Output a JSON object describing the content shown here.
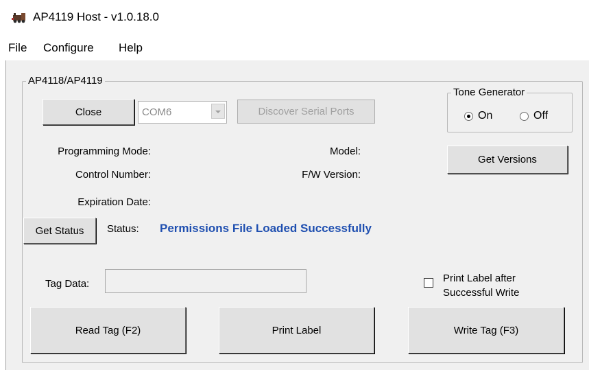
{
  "window": {
    "title": "AP4119 Host - v1.0.18.0"
  },
  "menu": {
    "items": [
      "File",
      "Configure",
      "Help"
    ]
  },
  "device_group": {
    "title": "AP4118/AP4119",
    "close_button": "Close",
    "port_select": {
      "value": "COM6"
    },
    "discover_button": "Discover Serial Ports",
    "programming_mode_label": "Programming Mode:",
    "control_number_label": "Control Number:",
    "expiration_date_label": "Expiration Date:",
    "model_label": "Model:",
    "fw_version_label": "F/W Version:",
    "get_versions_button": "Get Versions",
    "get_status_button": "Get Status",
    "status_label": "Status:",
    "status_value": "Permissions File Loaded Successfully",
    "status_color": "#1f4fb0",
    "tag_data_label": "Tag Data:",
    "tag_data_value": "",
    "print_label_checkbox": {
      "line1": "Print Label after",
      "line2": "Successful Write",
      "checked": false
    },
    "read_tag_button": "Read Tag (F2)",
    "print_label_button": "Print Label",
    "write_tag_button": "Write Tag (F3)"
  },
  "tone_generator": {
    "title": "Tone Generator",
    "on_label": "On",
    "off_label": "Off",
    "selected": "On"
  }
}
